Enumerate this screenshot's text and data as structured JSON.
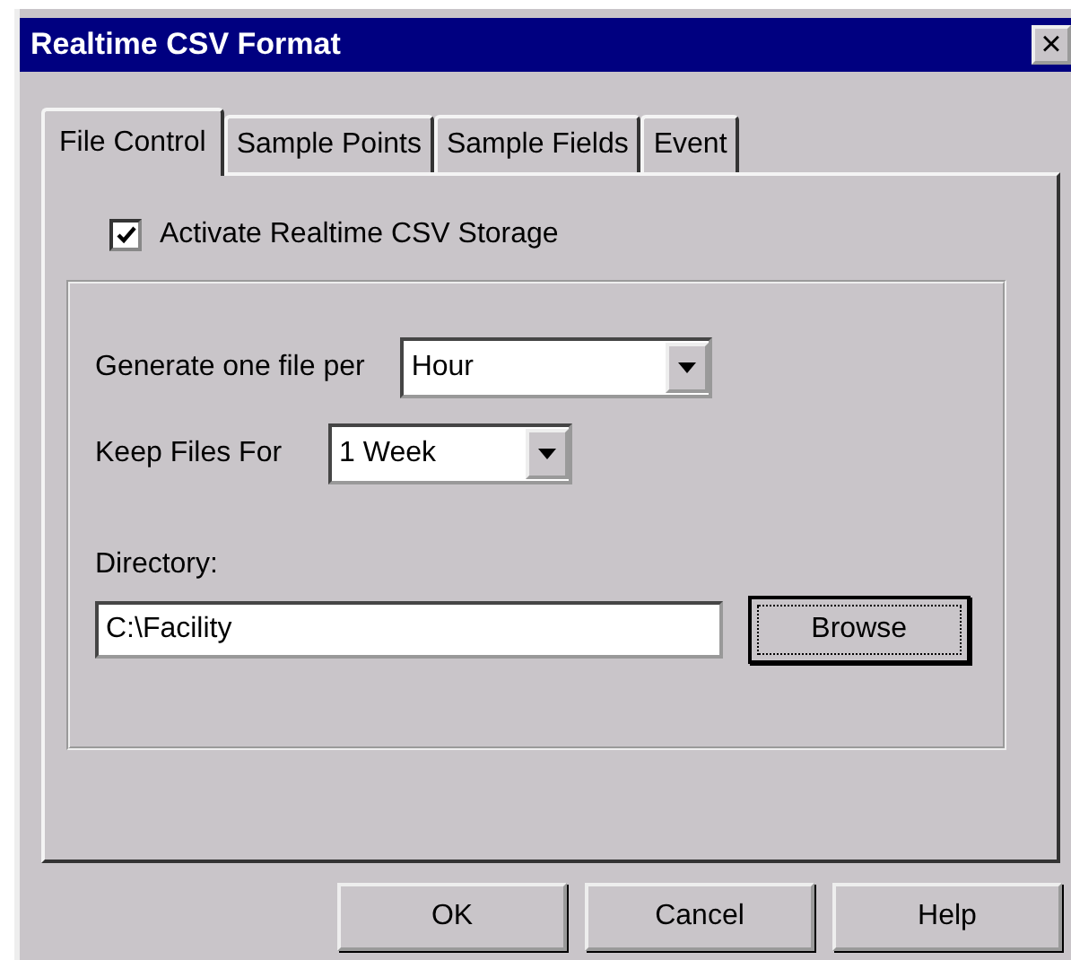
{
  "window": {
    "title": "Realtime CSV Format",
    "close": "×"
  },
  "tabs": [
    {
      "label": "File Control",
      "selected": true
    },
    {
      "label": "Sample Points",
      "selected": false
    },
    {
      "label": "Sample Fields",
      "selected": false
    },
    {
      "label": "Event",
      "selected": false
    }
  ],
  "activate": {
    "label": "Activate Realtime CSV Storage",
    "checked": true
  },
  "generate": {
    "label": "Generate one file per",
    "value": "Hour"
  },
  "keep": {
    "label": "Keep Files For",
    "value": "1 Week"
  },
  "directory": {
    "label": "Directory:",
    "value": "C:\\Facility",
    "browse": "Browse"
  },
  "buttons": [
    "OK",
    "Cancel",
    "Help"
  ]
}
